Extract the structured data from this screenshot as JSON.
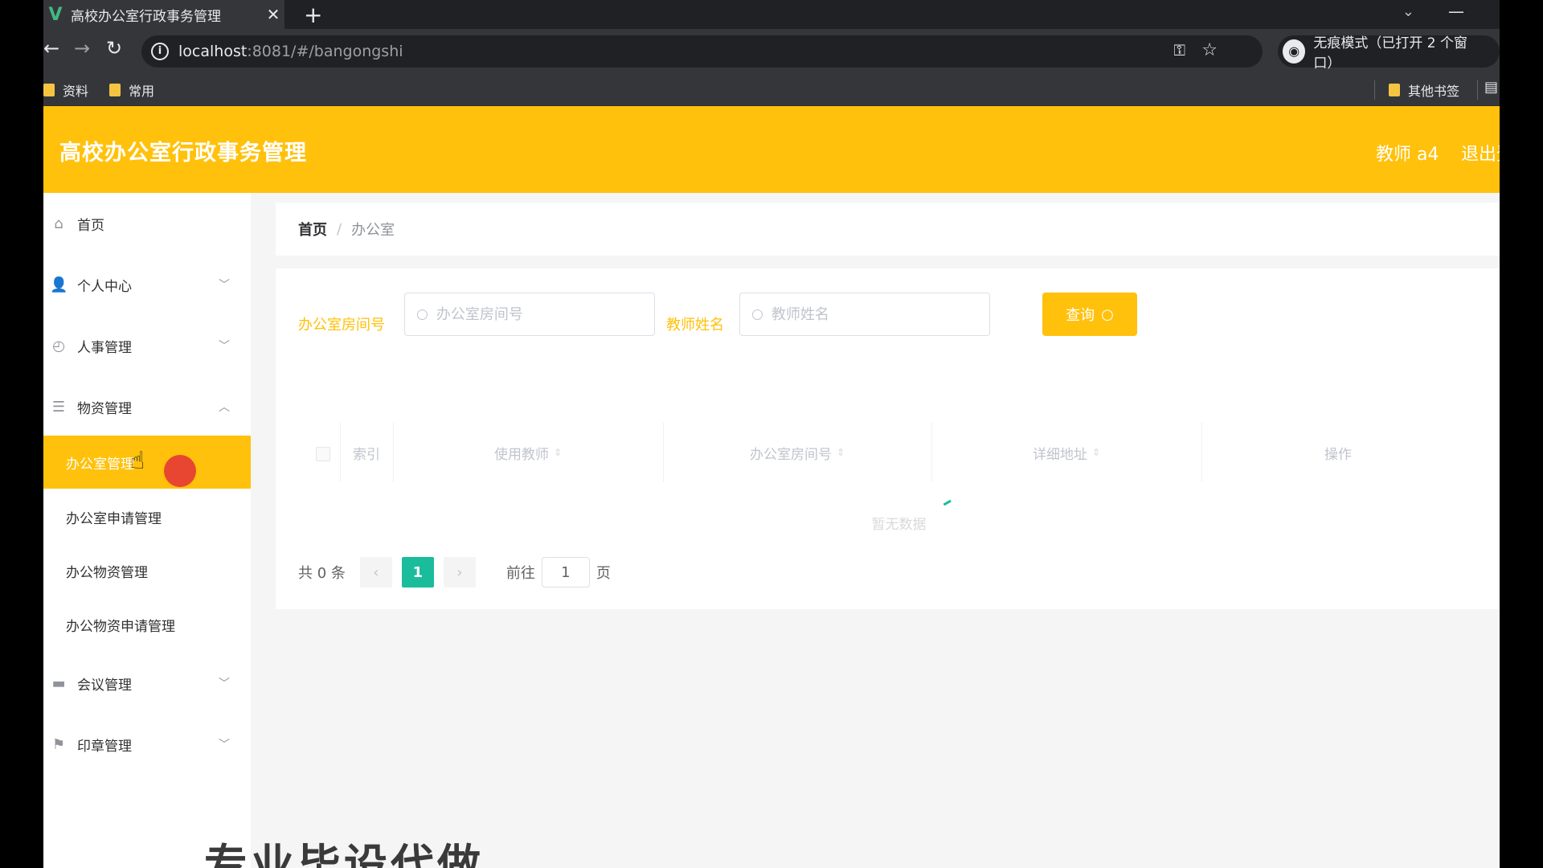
{
  "browser": {
    "tab_title": "高校办公室行政事务管理",
    "tab_close": "✕",
    "new_tab": "+",
    "url_host": "localhost",
    "url_rest": ":8081/#/bangongshi",
    "incognito_label": "无痕模式（已打开 2 个窗口）",
    "bookmarks": [
      "资料",
      "常用"
    ],
    "other_bookmarks": "其他书签"
  },
  "app": {
    "title": "高校办公室行政事务管理",
    "user": "教师 a4",
    "logout": "退出登录"
  },
  "sidebar": {
    "items": [
      {
        "label": "首页",
        "icon": "home-icon"
      },
      {
        "label": "个人中心",
        "icon": "user-icon"
      },
      {
        "label": "人事管理",
        "icon": "clock-icon"
      },
      {
        "label": "物资管理",
        "icon": "list-icon"
      },
      {
        "label": "会议管理",
        "icon": "meeting-icon"
      },
      {
        "label": "印章管理",
        "icon": "flag-icon"
      }
    ],
    "sub_items": [
      "办公室管理",
      "办公室申请管理",
      "办公物资管理",
      "办公物资申请管理"
    ]
  },
  "breadcrumb": {
    "home": "首页",
    "separator": "/",
    "current": "办公室"
  },
  "search": {
    "room_label": "办公室房间号",
    "room_placeholder": "办公室房间号",
    "teacher_label": "教师姓名",
    "teacher_placeholder": "教师姓名",
    "query_label": "查询"
  },
  "table": {
    "headers": [
      "索引",
      "使用教师",
      "办公室房间号",
      "详细地址",
      "操作"
    ],
    "empty_text": "暂无数据"
  },
  "pagination": {
    "total": "共 0 条",
    "current_page": "1",
    "goto_label": "前往",
    "goto_value": "1",
    "page_suffix": "页"
  },
  "overlay": {
    "watermark": "专业毕设代做"
  },
  "colors": {
    "accent": "#ffc10b",
    "page_active": "#1abc9c"
  }
}
